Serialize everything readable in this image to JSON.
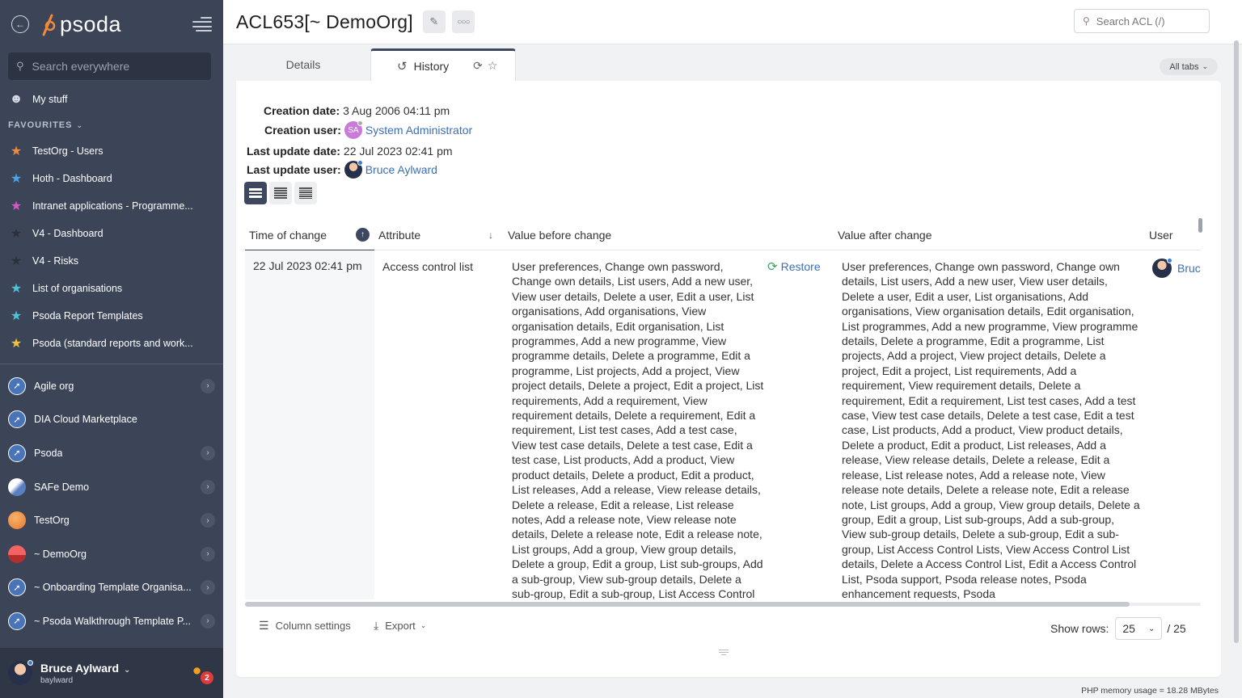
{
  "sidebar": {
    "logo_text": "psoda",
    "search_placeholder": "Search everywhere",
    "my_stuff": "My stuff",
    "favourites_header": "FAVOURITES",
    "favourites": [
      {
        "label": "TestOrg - Users",
        "color": "#f08a3c"
      },
      {
        "label": "Hoth - Dashboard",
        "color": "#4aa3e8"
      },
      {
        "label": "Intranet applications - Programme...",
        "color": "#d857c8"
      },
      {
        "label": "V4 - Dashboard",
        "color": "#2b2f3a"
      },
      {
        "label": "V4 - Risks",
        "color": "#2b2f3a"
      },
      {
        "label": "List of organisations",
        "color": "#4ec3d8"
      },
      {
        "label": "Psoda Report Templates",
        "color": "#4ec3d8"
      },
      {
        "label": "Psoda (standard reports and work...",
        "color": "#f2c23c"
      }
    ],
    "orgs": [
      {
        "label": "Agile org",
        "has_arrow": true
      },
      {
        "label": "DIA Cloud Marketplace",
        "has_arrow": false
      },
      {
        "label": "Psoda",
        "has_arrow": true
      },
      {
        "label": "SAFe Demo",
        "has_arrow": true
      },
      {
        "label": "TestOrg",
        "has_arrow": true
      },
      {
        "label": "~ DemoOrg",
        "has_arrow": true
      },
      {
        "label": "~ Onboarding Template Organisa...",
        "has_arrow": true
      },
      {
        "label": "~ Psoda Walkthrough Template P...",
        "has_arrow": true
      }
    ],
    "user": {
      "name": "Bruce Aylward",
      "login": "baylward",
      "notifications": "2"
    }
  },
  "header": {
    "title": "ACL653[~ DemoOrg]",
    "search_placeholder": "Search ACL (/)"
  },
  "tabs": {
    "details": "Details",
    "history": "History",
    "all_tabs": "All tabs"
  },
  "history": {
    "creation_date_label": "Creation date:",
    "creation_date": "3 Aug 2006 04:11 pm",
    "creation_user_label": "Creation user:",
    "creation_user_initials": "SA",
    "creation_user": "System Administrator",
    "last_update_date_label": "Last update date:",
    "last_update_date": "22 Jul 2023 02:41 pm",
    "last_update_user_label": "Last update user:",
    "last_update_user": "Bruce Aylward"
  },
  "table": {
    "columns": {
      "time": "Time of change",
      "attribute": "Attribute",
      "before": "Value before change",
      "after": "Value after change",
      "user": "User"
    },
    "row": {
      "time": "22 Jul 2023 02:41 pm",
      "attribute": "Access control list",
      "before": "User preferences, Change own password, Change own details, List users, Add a new user, View user details, Delete a user, Edit a user, List organisations, Add organisations, View organisation details, Edit organisation, List programmes, Add a new programme, View programme details, Delete a programme, Edit a programme, List projects, Add a project, View project details, Delete a project, Edit a project, List requirements, Add a requirement, View requirement details, Delete a requirement, Edit a requirement, List test cases, Add a test case, View test case details, Delete a test case, Edit a test case, List products, Add a product, View product details, Delete a product, Edit a product, List releases, Add a release, View release details, Delete a release, Edit a release, List release notes, Add a release note, View release note details, Delete a release note, Edit a release note, List groups, Add a group, View group details, Delete a group, Edit a group, List sub-groups, Add a sub-group, View sub-group details, Delete a sub-group, Edit a sub-group, List Access Control Lists,",
      "restore": "Restore",
      "after": "User preferences, Change own password, Change own details, List users, Add a new user, View user details, Delete a user, Edit a user, List organisations, Add organisations, View organisation details, Edit organisation, List programmes, Add a new programme, View programme details, Delete a programme, Edit a programme, List projects, Add a project, View project details, Delete a project, Edit a project, List requirements, Add a requirement, View requirement details, Delete a requirement, Edit a requirement, List test cases, Add a test case, View test case details, Delete a test case, Edit a test case, List products, Add a product, View product details, Delete a product, Edit a product, List releases, Add a release, View release details, Delete a release, Edit a release, List release notes, Add a release note, View release note details, Delete a release note, Edit a release note, List groups, Add a group, View group details, Delete a group, Edit a group, List sub-groups, Add a sub-group, View sub-group details, Delete a sub-group, Edit a sub-group, List Access Control Lists, View Access Control List details, Delete a Access Control List, Edit a Access Control List, Psoda support, Psoda release notes, Psoda enhancement requests, Psoda",
      "user": "Bruc"
    }
  },
  "footer": {
    "column_settings": "Column settings",
    "export": "Export",
    "show_rows_label": "Show rows:",
    "rows_value": "25",
    "rows_total": "/ 25"
  },
  "memory": "PHP memory usage = 18.28 MBytes",
  "colors": {
    "sidebar_bg": "#3c4457",
    "accent": "#3d4760",
    "link": "#3a6fb5",
    "logo_orange": "#f08a3c"
  }
}
